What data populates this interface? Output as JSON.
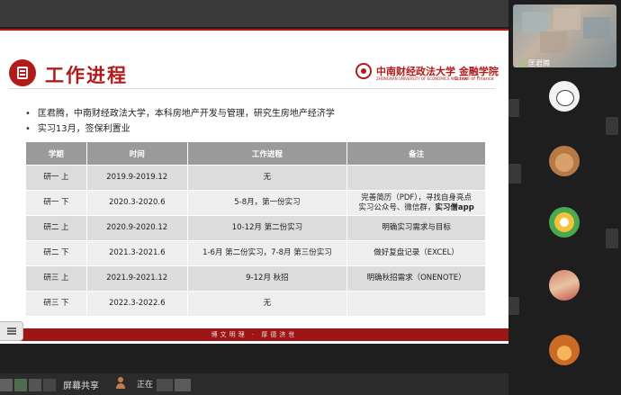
{
  "slide": {
    "title": "工作进程",
    "university": "中南财经政法大学 金融学院",
    "university_en": "ZHONGNAN UNIVERSITY OF ECONOMICS AND LAW",
    "school_en": "School of Finance",
    "bullets": [
      "匡君腾，中南财经政法大学，本科房地产开发与管理，研究生房地产经济学",
      "实习13月，签保利置业"
    ],
    "table": {
      "headers": [
        "学期",
        "时间",
        "工作进程",
        "备注"
      ],
      "rows": [
        {
          "term": "研一 上",
          "time": "2019.9-2019.12",
          "progress": "无",
          "note": ""
        },
        {
          "term": "研一 下",
          "time": "2020.3-2020.6",
          "progress": "5-8月，第一份实习",
          "note": "完善简历（PDF），寻找自身亮点",
          "note2": "实习公众号、微信群，",
          "note2_bold": "实习僧app"
        },
        {
          "term": "研二 上",
          "time": "2020.9-2020.12",
          "progress": "10-12月 第二份实习",
          "note": "明确实习需求与目标"
        },
        {
          "term": "研二 下",
          "time": "2021.3-2021.6",
          "progress": "1-6月 第二份实习，7-8月 第三份实习",
          "note": "做好复盘记录（EXCEL）"
        },
        {
          "term": "研三 上",
          "time": "2021.9-2021.12",
          "progress": "9-12月 秋招",
          "note": "明确秋招需求（ONENOTE）"
        },
        {
          "term": "研三 下",
          "time": "2022.3-2022.6",
          "progress": "无",
          "note": ""
        }
      ]
    },
    "footer_motto": "博文明理 · 厚德济世"
  },
  "participants": {
    "self_name": "匡君腾"
  },
  "bottombar": {
    "share_label": "屏幕共享",
    "status_label": "正在"
  },
  "icons": [
    "document-icon",
    "university-logo-icon",
    "microphone-icon",
    "menu-icon",
    "user-icon"
  ],
  "colors": {
    "accent": "#b31b1b",
    "table_header": "#9a9a9a",
    "footer": "#9e1515"
  }
}
